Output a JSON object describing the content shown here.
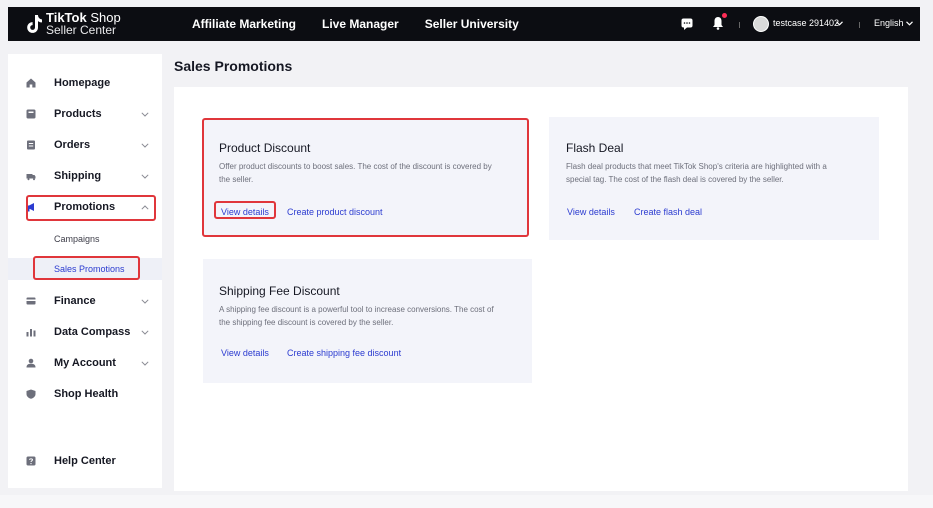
{
  "brand": {
    "line1_bold": "TikTok",
    "line1_rest": " Shop",
    "line2": "Seller Center"
  },
  "topnav": [
    "Affiliate Marketing",
    "Live Manager",
    "Seller University"
  ],
  "user": {
    "name": "testcase 291402"
  },
  "language": "English",
  "sidebar": {
    "items": [
      {
        "label": "Homepage",
        "icon": "home-icon"
      },
      {
        "label": "Products",
        "icon": "products-icon"
      },
      {
        "label": "Orders",
        "icon": "orders-icon"
      },
      {
        "label": "Shipping",
        "icon": "shipping-icon"
      },
      {
        "label": "Promotions",
        "icon": "promotions-icon"
      },
      {
        "label": "Finance",
        "icon": "finance-icon"
      },
      {
        "label": "Data Compass",
        "icon": "data-compass-icon"
      },
      {
        "label": "My Account",
        "icon": "account-icon"
      },
      {
        "label": "Shop Health",
        "icon": "shop-health-icon"
      },
      {
        "label": "Help Center",
        "icon": "help-center-icon"
      }
    ],
    "sub_items": [
      "Campaigns",
      "Sales Promotions"
    ]
  },
  "page_title": "Sales Promotions",
  "cards": [
    {
      "title": "Product Discount",
      "desc1": "Offer product discounts to boost sales. The cost of the discount is covered by",
      "desc2": "the seller.",
      "link1": "View details",
      "link2": "Create product discount"
    },
    {
      "title": "Flash Deal",
      "desc1": "Flash deal products that meet TikTok Shop's criteria are highlighted with a",
      "desc2": "special tag. The cost of the flash deal is covered by the seller.",
      "link1": "View details",
      "link2": "Create flash deal"
    },
    {
      "title": "Shipping Fee Discount",
      "desc1": "A shipping fee discount is a powerful tool to increase conversions. The cost of",
      "desc2": "the shipping fee discount is covered by the seller.",
      "link1": "View details",
      "link2": "Create shipping fee discount"
    }
  ],
  "colors": {
    "accent": "#2b3bd0",
    "highlight": "#e0363b",
    "topbar": "#0c0d12"
  }
}
